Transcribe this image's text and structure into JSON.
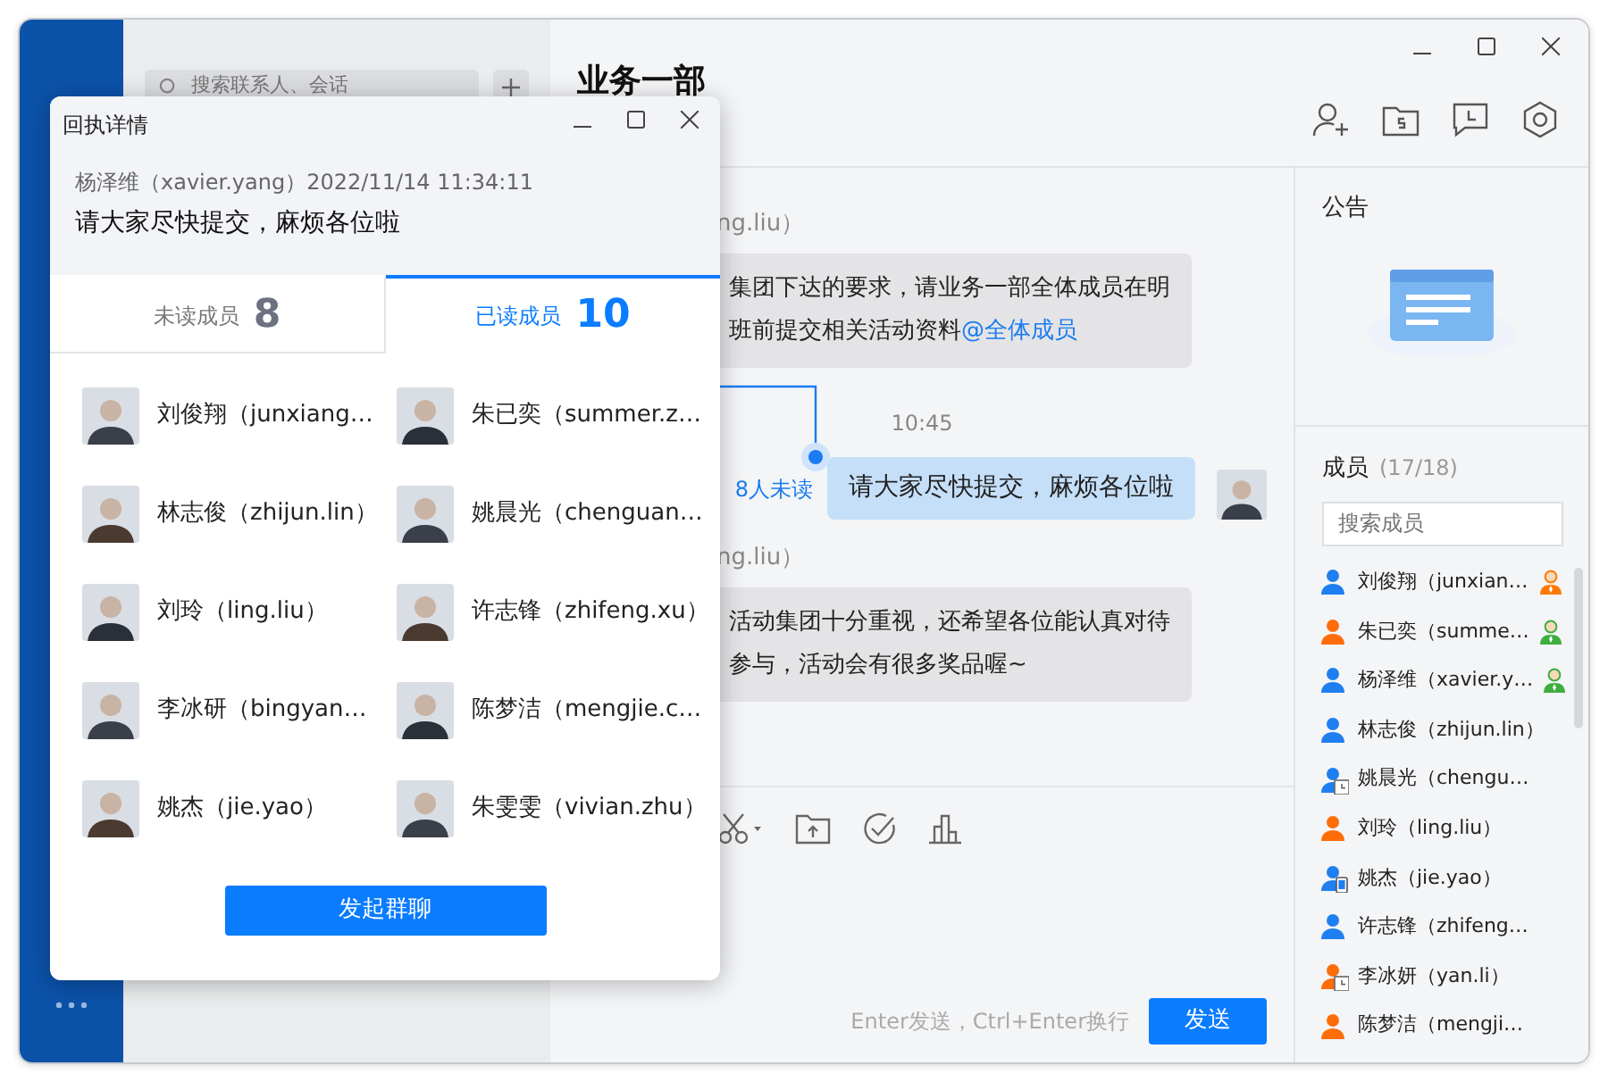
{
  "contacts_pane": {
    "search": {
      "placeholder": "搜索联系人、会话"
    }
  },
  "chat": {
    "title": "业务一部",
    "messages": [
      {
        "kind": "incoming",
        "sender": "ng.liu）",
        "lines": [
          "集团下达的要求，请业务一部全体成员在明",
          "班前提交相关活动资料"
        ],
        "mention": "@全体成员"
      },
      {
        "kind": "time",
        "text": "10:45"
      },
      {
        "kind": "outgoing",
        "text": "请大家尽快提交，麻烦各位啦",
        "unread": "8人未读"
      },
      {
        "kind": "incoming",
        "sender": "ng.liu）",
        "lines": [
          "活动集团十分重视，还希望各位能认真对待",
          "参与，活动会有很多奖品喔~"
        ]
      }
    ],
    "composer": {
      "hint": "Enter发送，Ctrl+Enter换行",
      "send": "发送"
    }
  },
  "side": {
    "notice_title": "公告",
    "members_title": "成员",
    "members_count": "(17/18)",
    "search": {
      "placeholder": "搜索成员"
    },
    "members": [
      {
        "name": "刘俊翔（junxian…",
        "color": "#1f7ff0",
        "owner": true,
        "admin": false,
        "away": false,
        "mobile": false
      },
      {
        "name": "朱已奕（summe…",
        "color": "#ff6d0a",
        "owner": false,
        "admin": true,
        "away": false,
        "mobile": false
      },
      {
        "name": "杨泽维（xavier.y…",
        "color": "#1f7ff0",
        "owner": false,
        "admin": true,
        "away": false,
        "mobile": false
      },
      {
        "name": "林志俊（zhijun.lin）",
        "color": "#1f7ff0",
        "owner": false,
        "admin": false,
        "away": false,
        "mobile": false
      },
      {
        "name": "姚晨光（chengu…",
        "color": "#1f7ff0",
        "owner": false,
        "admin": false,
        "away": true,
        "mobile": false
      },
      {
        "name": "刘玲（ling.liu）",
        "color": "#ff6d0a",
        "owner": false,
        "admin": false,
        "away": false,
        "mobile": false
      },
      {
        "name": "姚杰（jie.yao）",
        "color": "#1f7ff0",
        "owner": false,
        "admin": false,
        "away": false,
        "mobile": true
      },
      {
        "name": "许志锋（zhifeng…",
        "color": "#1f7ff0",
        "owner": false,
        "admin": false,
        "away": false,
        "mobile": false
      },
      {
        "name": "李冰妍（yan.li）",
        "color": "#ff6d0a",
        "owner": false,
        "admin": false,
        "away": true,
        "mobile": false
      },
      {
        "name": "陈梦洁（mengji…",
        "color": "#ff6d0a",
        "owner": false,
        "admin": false,
        "away": false,
        "mobile": false
      }
    ]
  },
  "dialog": {
    "title": "回执详情",
    "sender": "杨泽维（xavier.yang）2022/11/14  11:34:11",
    "message": "请大家尽快提交，麻烦各位啦",
    "tabs": [
      {
        "label": "未读成员",
        "count": "8",
        "selected": false
      },
      {
        "label": "已读成员",
        "count": "10",
        "selected": true
      }
    ],
    "members": [
      "刘俊翔（junxiang…",
      "朱已奕（summer.z…",
      "林志俊（zhijun.lin）",
      "姚晨光（chenguan…",
      "刘玲（ling.liu）",
      "许志锋（zhifeng.xu）",
      "李冰研（bingyan…",
      "陈梦洁（mengjie.c…",
      "姚杰（jie.yao）",
      "朱雯雯（vivian.zhu）"
    ],
    "button": "发起群聊"
  }
}
